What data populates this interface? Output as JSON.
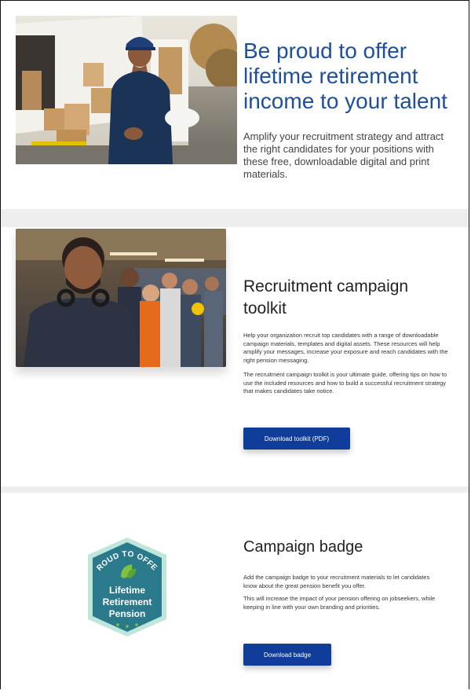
{
  "hero": {
    "title": "Be proud to offer lifetime retirement income to your talent",
    "description": "Amplify your recruitment strategy and attract the right candidates for your positions with these free, downloadable digital and print materials."
  },
  "toolkit": {
    "title": "Recruitment campaign toolkit",
    "paragraph1": "Help your organization recruit top candidates with a range of downloadable campaign materials, templates and digital assets. These resources will help amplify your messages, increase your exposure and reach candidates with the right pension messaging.",
    "paragraph2": "The recruitment campaign toolkit is your ultimate guide, offering tips on how to use the included resources and how to build a successful recruitment strategy that makes candidates take notice.",
    "button_label": "Download toolkit (PDF)"
  },
  "badge_section": {
    "title": "Campaign badge",
    "paragraph1": "Add the campaign badge to your recruitment materials to let candidates know about the great pension benefit you offer.",
    "paragraph2": "This will increase the impact of your pension offering on jobseekers, while keeping in line with your own branding and priorities.",
    "button_label": "Download badge",
    "badge": {
      "arc_text": "PROUD TO OFFER",
      "line1": "Lifetime",
      "line2": "Retirement",
      "line3": "Pension"
    }
  },
  "colors": {
    "title_blue": "#1d4f9c",
    "button_blue": "#0f3d99",
    "badge_teal": "#2b7a8c",
    "badge_green": "#7ec242"
  },
  "icons": [
    "leaf-icon"
  ]
}
